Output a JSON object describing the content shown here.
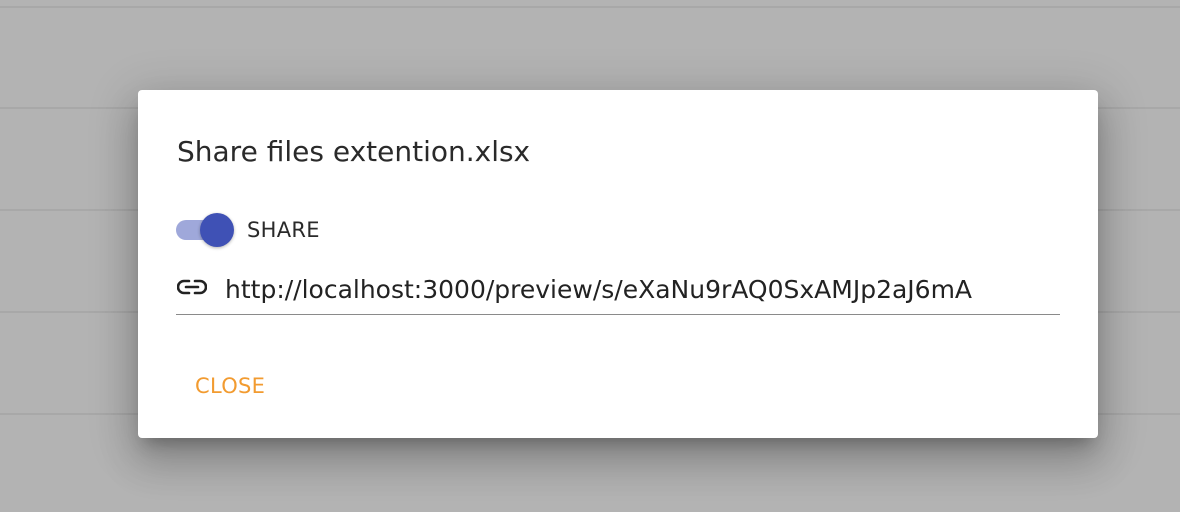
{
  "dialog": {
    "title": "Share files extention.xlsx",
    "share_toggle": {
      "label": "SHARE",
      "checked": true,
      "thumb_color": "#3f51b5",
      "track_color": "#9fa8da"
    },
    "link_field": {
      "icon": "link-icon",
      "value": "http://localhost:3000/preview/s/eXaNu9rAQ0SxAMJp2aJ6mA"
    },
    "actions": {
      "close_label": "CLOSE",
      "close_color": "#f29b30"
    }
  },
  "backdrop_color": "#b3b3b3"
}
